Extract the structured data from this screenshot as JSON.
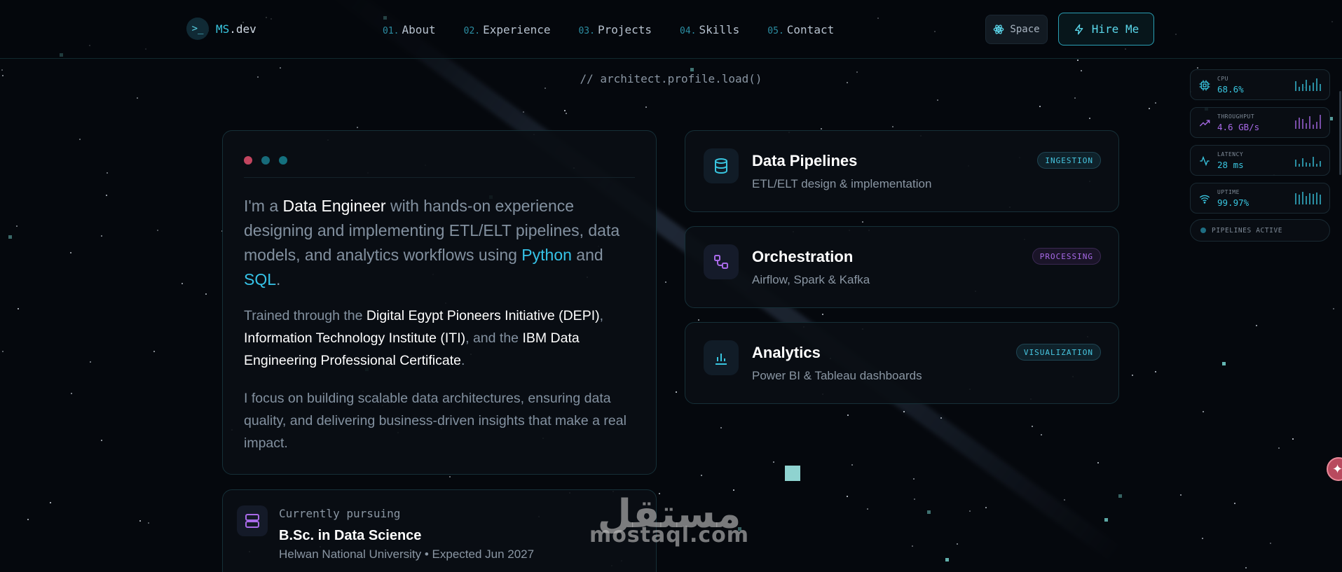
{
  "nav": {
    "logo_prompt": ">_",
    "logo_name": "MS",
    "logo_tld": ".dev",
    "links": [
      {
        "num": "01.",
        "label": "About"
      },
      {
        "num": "02.",
        "label": "Experience"
      },
      {
        "num": "03.",
        "label": "Projects"
      },
      {
        "num": "04.",
        "label": "Skills"
      },
      {
        "num": "05.",
        "label": "Contact"
      }
    ],
    "space_label": "Space",
    "hire_label": "Hire Me"
  },
  "subtitle": "// architect.profile.load()",
  "about": {
    "p1_a": "I'm a ",
    "p1_role": "Data Engineer",
    "p1_b": " with hands-on experience designing and implementing ETL/ELT pipelines, data models, and analytics workflows using ",
    "p1_python": "Python",
    "p1_and": " and ",
    "p1_sql": "SQL",
    "p1_end": ".",
    "p2_a": "Trained through the ",
    "p2_depi": "Digital Egypt Pioneers Initiative (DEPI)",
    "p2_comma": ", ",
    "p2_iti": "Information Technology Institute (ITI)",
    "p2_and": ", and the ",
    "p2_ibm": "IBM Data Engineering Professional Certificate",
    "p2_end": ".",
    "p3": "I focus on building scalable data architectures, ensuring data quality, and delivering business-driven insights that make a real impact."
  },
  "education": {
    "label": "Currently pursuing",
    "degree": "B.Sc. in Data Science",
    "meta": "Helwan National University • Expected Jun 2027"
  },
  "features": [
    {
      "title": "Data Pipelines",
      "desc": "ETL/ELT design & implementation",
      "badge": "INGESTION",
      "icon": "database-icon"
    },
    {
      "title": "Orchestration",
      "desc": "Airflow, Spark & Kafka",
      "badge": "PROCESSING",
      "icon": "workflow-icon"
    },
    {
      "title": "Analytics",
      "desc": "Power BI & Tableau dashboards",
      "badge": "VISUALIZATION",
      "icon": "bar-chart-icon"
    }
  ],
  "metrics": [
    {
      "label": "CPU",
      "value": "68.6%",
      "color": "#39c6e0"
    },
    {
      "label": "THROUGHPUT",
      "value": "4.6 GB/s",
      "color": "#a86ae8"
    },
    {
      "label": "LATENCY",
      "value": "28 ms",
      "color": "#39c6e0"
    },
    {
      "label": "UPTIME",
      "value": "99.97%",
      "color": "#39c6e0"
    }
  ],
  "pipelines_status": "PIPELINES ACTIVE",
  "watermark": {
    "arabic": "مستقل",
    "latin": "mostaql.com"
  },
  "colors": {
    "accent": "#39c6e0",
    "purple": "#a86ae8",
    "background": "#05080d"
  }
}
